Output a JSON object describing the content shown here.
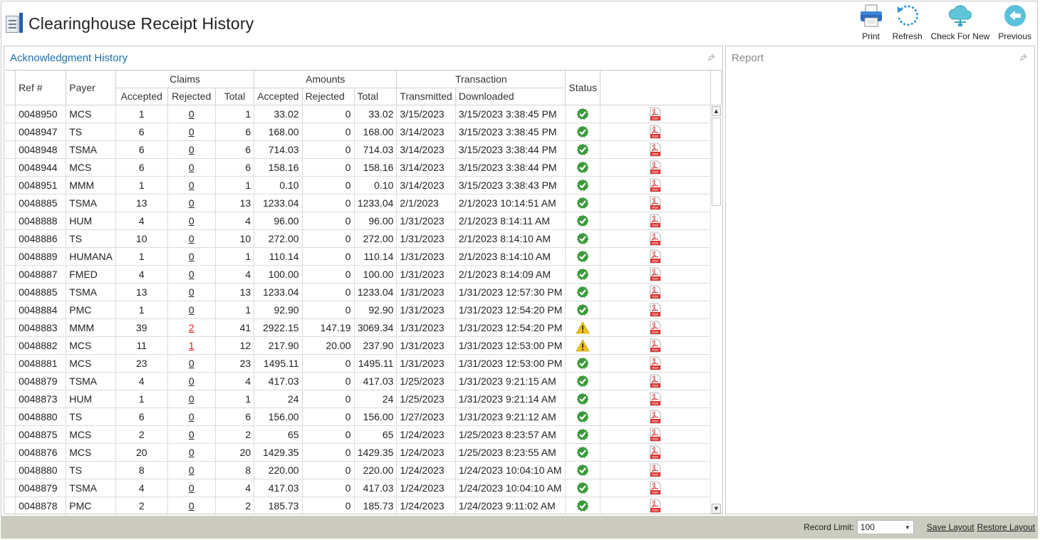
{
  "app": {
    "title": "Clearinghouse Receipt History"
  },
  "toolbar": {
    "print": "Print",
    "refresh": "Refresh",
    "check_for_new": "Check For New",
    "previous": "Previous"
  },
  "left_panel": {
    "title": "Acknowledgment History"
  },
  "right_panel": {
    "title": "Report"
  },
  "grid": {
    "groups": {
      "claims": "Claims",
      "amounts": "Amounts",
      "transaction": "Transaction"
    },
    "headers": {
      "ref": "Ref #",
      "payer": "Payer",
      "claims_accepted": "Accepted",
      "claims_rejected": "Rejected",
      "claims_total": "Total",
      "amt_accepted": "Accepted",
      "amt_rejected": "Rejected",
      "amt_total": "Total",
      "transmitted": "Transmitted",
      "downloaded": "Downloaded",
      "status": "Status"
    },
    "rows": [
      {
        "ref": "0048950",
        "payer": "MCS",
        "ca": "1",
        "cr": "0",
        "ct": "1",
        "aa": "33.02",
        "ar": "0",
        "at": "33.02",
        "tx": "3/15/2023",
        "dl": "3/15/2023 3:38:45 PM",
        "status": "ok"
      },
      {
        "ref": "0048947",
        "payer": "TS",
        "ca": "6",
        "cr": "0",
        "ct": "6",
        "aa": "168.00",
        "ar": "0",
        "at": "168.00",
        "tx": "3/14/2023",
        "dl": "3/15/2023 3:38:45 PM",
        "status": "ok"
      },
      {
        "ref": "0048948",
        "payer": "TSMA",
        "ca": "6",
        "cr": "0",
        "ct": "6",
        "aa": "714.03",
        "ar": "0",
        "at": "714.03",
        "tx": "3/14/2023",
        "dl": "3/15/2023 3:38:44 PM",
        "status": "ok"
      },
      {
        "ref": "0048944",
        "payer": "MCS",
        "ca": "6",
        "cr": "0",
        "ct": "6",
        "aa": "158.16",
        "ar": "0",
        "at": "158.16",
        "tx": "3/14/2023",
        "dl": "3/15/2023 3:38:44 PM",
        "status": "ok"
      },
      {
        "ref": "0048951",
        "payer": "MMM",
        "ca": "1",
        "cr": "0",
        "ct": "1",
        "aa": "0.10",
        "ar": "0",
        "at": "0.10",
        "tx": "3/14/2023",
        "dl": "3/15/2023 3:38:43 PM",
        "status": "ok"
      },
      {
        "ref": "0048885",
        "payer": "TSMA",
        "ca": "13",
        "cr": "0",
        "ct": "13",
        "aa": "1233.04",
        "ar": "0",
        "at": "1233.04",
        "tx": "2/1/2023",
        "dl": "2/1/2023 10:14:51 AM",
        "status": "ok"
      },
      {
        "ref": "0048888",
        "payer": "HUM",
        "ca": "4",
        "cr": "0",
        "ct": "4",
        "aa": "96.00",
        "ar": "0",
        "at": "96.00",
        "tx": "1/31/2023",
        "dl": "2/1/2023 8:14:11 AM",
        "status": "ok"
      },
      {
        "ref": "0048886",
        "payer": "TS",
        "ca": "10",
        "cr": "0",
        "ct": "10",
        "aa": "272.00",
        "ar": "0",
        "at": "272.00",
        "tx": "1/31/2023",
        "dl": "2/1/2023 8:14:10 AM",
        "status": "ok"
      },
      {
        "ref": "0048889",
        "payer": "HUMANA",
        "ca": "1",
        "cr": "0",
        "ct": "1",
        "aa": "110.14",
        "ar": "0",
        "at": "110.14",
        "tx": "1/31/2023",
        "dl": "2/1/2023 8:14:10 AM",
        "status": "ok"
      },
      {
        "ref": "0048887",
        "payer": "FMED",
        "ca": "4",
        "cr": "0",
        "ct": "4",
        "aa": "100.00",
        "ar": "0",
        "at": "100.00",
        "tx": "1/31/2023",
        "dl": "2/1/2023 8:14:09 AM",
        "status": "ok"
      },
      {
        "ref": "0048885",
        "payer": "TSMA",
        "ca": "13",
        "cr": "0",
        "ct": "13",
        "aa": "1233.04",
        "ar": "0",
        "at": "1233.04",
        "tx": "1/31/2023",
        "dl": "1/31/2023 12:57:30 PM",
        "status": "ok"
      },
      {
        "ref": "0048884",
        "payer": "PMC",
        "ca": "1",
        "cr": "0",
        "ct": "1",
        "aa": "92.90",
        "ar": "0",
        "at": "92.90",
        "tx": "1/31/2023",
        "dl": "1/31/2023 12:54:20 PM",
        "status": "ok"
      },
      {
        "ref": "0048883",
        "payer": "MMM",
        "ca": "39",
        "cr": "2",
        "ct": "41",
        "aa": "2922.15",
        "ar": "147.19",
        "at": "3069.34",
        "tx": "1/31/2023",
        "dl": "1/31/2023 12:54:20 PM",
        "status": "warn"
      },
      {
        "ref": "0048882",
        "payer": "MCS",
        "ca": "11",
        "cr": "1",
        "ct": "12",
        "aa": "217.90",
        "ar": "20.00",
        "at": "237.90",
        "tx": "1/31/2023",
        "dl": "1/31/2023 12:53:00 PM",
        "status": "warn"
      },
      {
        "ref": "0048881",
        "payer": "MCS",
        "ca": "23",
        "cr": "0",
        "ct": "23",
        "aa": "1495.11",
        "ar": "0",
        "at": "1495.11",
        "tx": "1/31/2023",
        "dl": "1/31/2023 12:53:00 PM",
        "status": "ok"
      },
      {
        "ref": "0048879",
        "payer": "TSMA",
        "ca": "4",
        "cr": "0",
        "ct": "4",
        "aa": "417.03",
        "ar": "0",
        "at": "417.03",
        "tx": "1/25/2023",
        "dl": "1/31/2023 9:21:15 AM",
        "status": "ok"
      },
      {
        "ref": "0048873",
        "payer": "HUM",
        "ca": "1",
        "cr": "0",
        "ct": "1",
        "aa": "24",
        "ar": "0",
        "at": "24",
        "tx": "1/25/2023",
        "dl": "1/31/2023 9:21:14 AM",
        "status": "ok"
      },
      {
        "ref": "0048880",
        "payer": "TS",
        "ca": "6",
        "cr": "0",
        "ct": "6",
        "aa": "156.00",
        "ar": "0",
        "at": "156.00",
        "tx": "1/27/2023",
        "dl": "1/31/2023 9:21:12 AM",
        "status": "ok"
      },
      {
        "ref": "0048875",
        "payer": "MCS",
        "ca": "2",
        "cr": "0",
        "ct": "2",
        "aa": "65",
        "ar": "0",
        "at": "65",
        "tx": "1/24/2023",
        "dl": "1/25/2023 8:23:57 AM",
        "status": "ok"
      },
      {
        "ref": "0048876",
        "payer": "MCS",
        "ca": "20",
        "cr": "0",
        "ct": "20",
        "aa": "1429.35",
        "ar": "0",
        "at": "1429.35",
        "tx": "1/24/2023",
        "dl": "1/25/2023 8:23:55 AM",
        "status": "ok"
      },
      {
        "ref": "0048880",
        "payer": "TS",
        "ca": "8",
        "cr": "0",
        "ct": "8",
        "aa": "220.00",
        "ar": "0",
        "at": "220.00",
        "tx": "1/24/2023",
        "dl": "1/24/2023 10:04:10 AM",
        "status": "ok"
      },
      {
        "ref": "0048879",
        "payer": "TSMA",
        "ca": "4",
        "cr": "0",
        "ct": "4",
        "aa": "417.03",
        "ar": "0",
        "at": "417.03",
        "tx": "1/24/2023",
        "dl": "1/24/2023 10:04:10 AM",
        "status": "ok"
      },
      {
        "ref": "0048878",
        "payer": "PMC",
        "ca": "2",
        "cr": "0",
        "ct": "2",
        "aa": "185.73",
        "ar": "0",
        "at": "185.73",
        "tx": "1/24/2023",
        "dl": "1/24/2023 9:11:02 AM",
        "status": "ok"
      }
    ]
  },
  "status_bar": {
    "record_limit_label": "Record Limit:",
    "record_limit_value": "100",
    "save_layout": "Save Layout",
    "restore_layout": "Restore Layout"
  },
  "colors": {
    "accent": "#1e6fb0",
    "ok": "#3a9a3a",
    "warn": "#e8c21a",
    "error": "#d22222",
    "status_bar": "#cbcbc0"
  }
}
